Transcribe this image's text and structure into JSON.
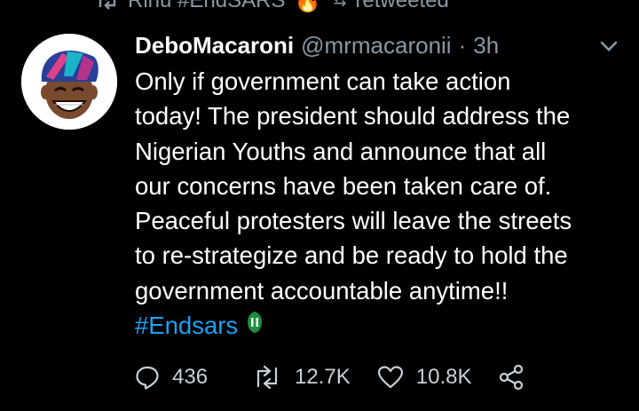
{
  "retweet_context": {
    "text": "Rinu #EndSARS",
    "emoji": "🔥",
    "suffix": "retweeted"
  },
  "tweet": {
    "display_name": "DeboMacaroni",
    "handle": "@mrmacaronii",
    "separator": "·",
    "time": "3h",
    "body_lines": [
      "Only if government can take action",
      "today! The president should address the",
      "Nigerian Youths and announce that all",
      "our concerns have been taken care of.",
      "Peaceful protesters will leave the streets",
      "to re-strategize and be ready to hold the",
      "government accountable anytime!!"
    ],
    "hashtag": "#Endsars"
  },
  "actions": {
    "reply_count": "436",
    "retweet_count": "12.7K",
    "like_count": "10.8K"
  },
  "colors": {
    "background": "#000000",
    "text": "#ffffff",
    "secondary": "#8899a6",
    "link": "#1da1f2"
  },
  "icons": {
    "retweet_context": "retweet-icon",
    "menu": "chevron-down-icon",
    "hashtag_emoji": "endsars-badge-icon",
    "reply": "reply-icon",
    "retweet": "retweet-icon",
    "like": "heart-icon",
    "share": "share-icon"
  }
}
